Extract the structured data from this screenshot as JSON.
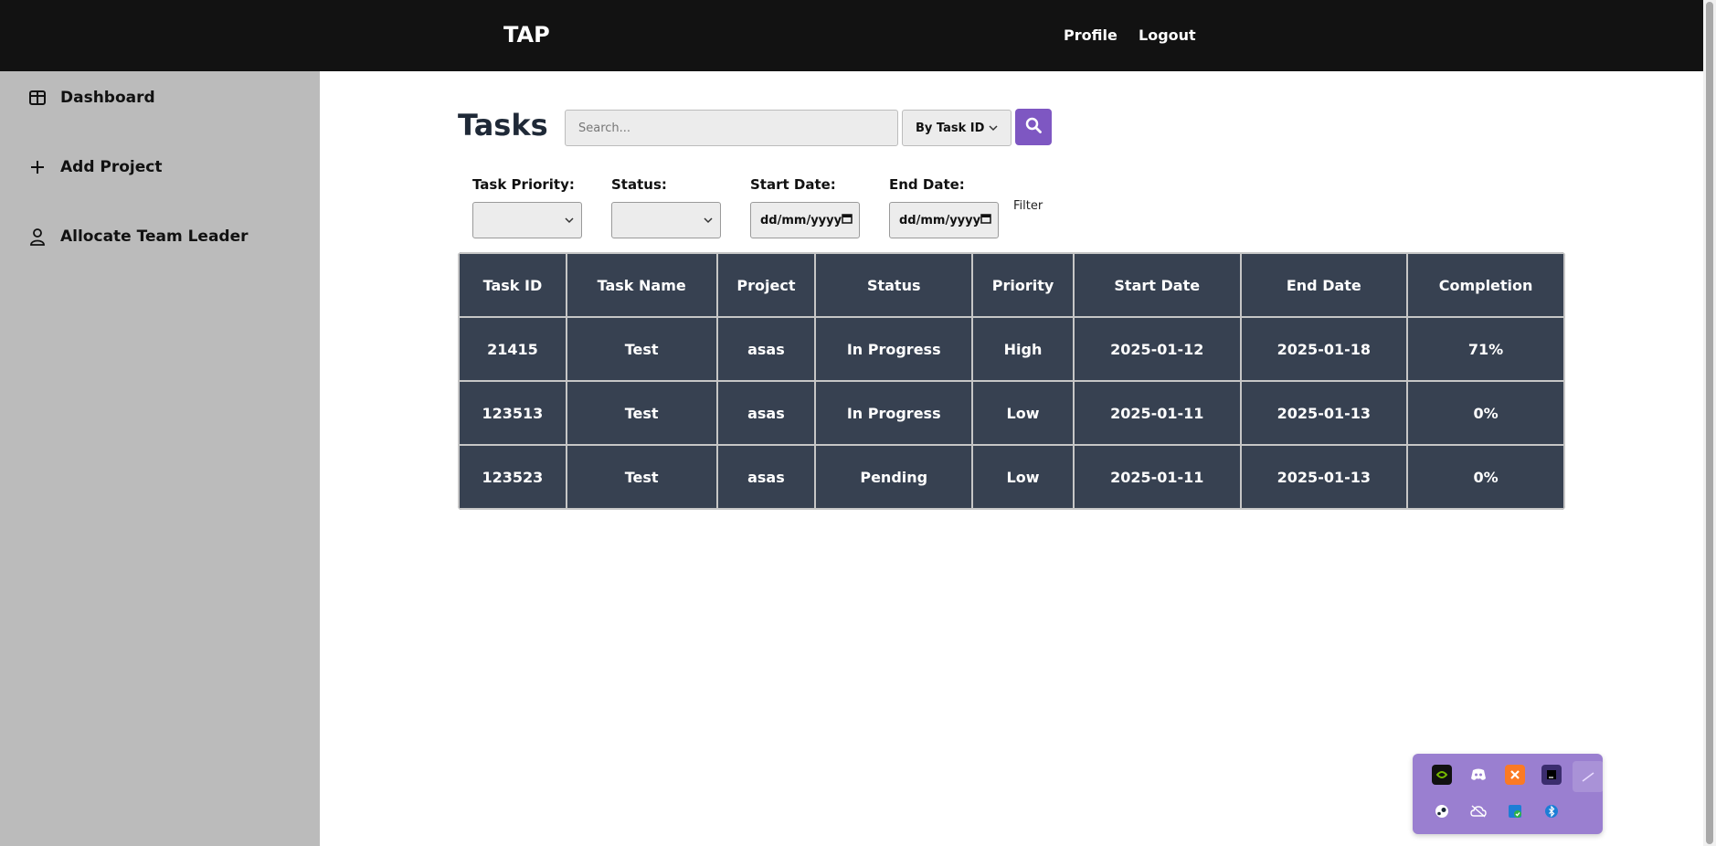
{
  "header": {
    "brand": "TAP",
    "nav": [
      "Profile",
      "Logout"
    ]
  },
  "sidebar": {
    "items": [
      {
        "label": "Dashboard",
        "icon": "dashboard-icon"
      },
      {
        "label": "Add Project",
        "icon": "plus-icon"
      },
      {
        "label": "Allocate Team Leader",
        "icon": "user-icon"
      }
    ]
  },
  "main": {
    "title": "Tasks",
    "search": {
      "placeholder": "Search...",
      "value": "",
      "by_label": "By Task ID"
    },
    "filters": {
      "priority_label": "Task Priority:",
      "status_label": "Status:",
      "start_label": "Start Date:",
      "end_label": "End Date:",
      "date_placeholder": "dd/mm/yyyy",
      "filter_link": "Filter"
    },
    "table": {
      "headers": [
        "Task ID",
        "Task Name",
        "Project",
        "Status",
        "Priority",
        "Start Date",
        "End Date",
        "Completion"
      ],
      "rows": [
        [
          "21415",
          "Test",
          "asas",
          "In Progress",
          "High",
          "2025-01-12",
          "2025-01-18",
          "71%"
        ],
        [
          "123513",
          "Test",
          "asas",
          "In Progress",
          "Low",
          "2025-01-11",
          "2025-01-13",
          "0%"
        ],
        [
          "123523",
          "Test",
          "asas",
          "Pending",
          "Low",
          "2025-01-11",
          "2025-01-13",
          "0%"
        ]
      ]
    }
  },
  "tray": {
    "icons": [
      "nvidia-icon",
      "discord-icon",
      "xampp-icon",
      "intellij-icon",
      "pen-icon",
      "steam-icon",
      "cloud-off-icon",
      "defender-icon",
      "bluetooth-icon"
    ]
  },
  "colors": {
    "accent": "#7e57c2",
    "table_bg": "#374151",
    "sidebar_bg": "#bbbbbb",
    "topbar_bg": "#121212"
  }
}
